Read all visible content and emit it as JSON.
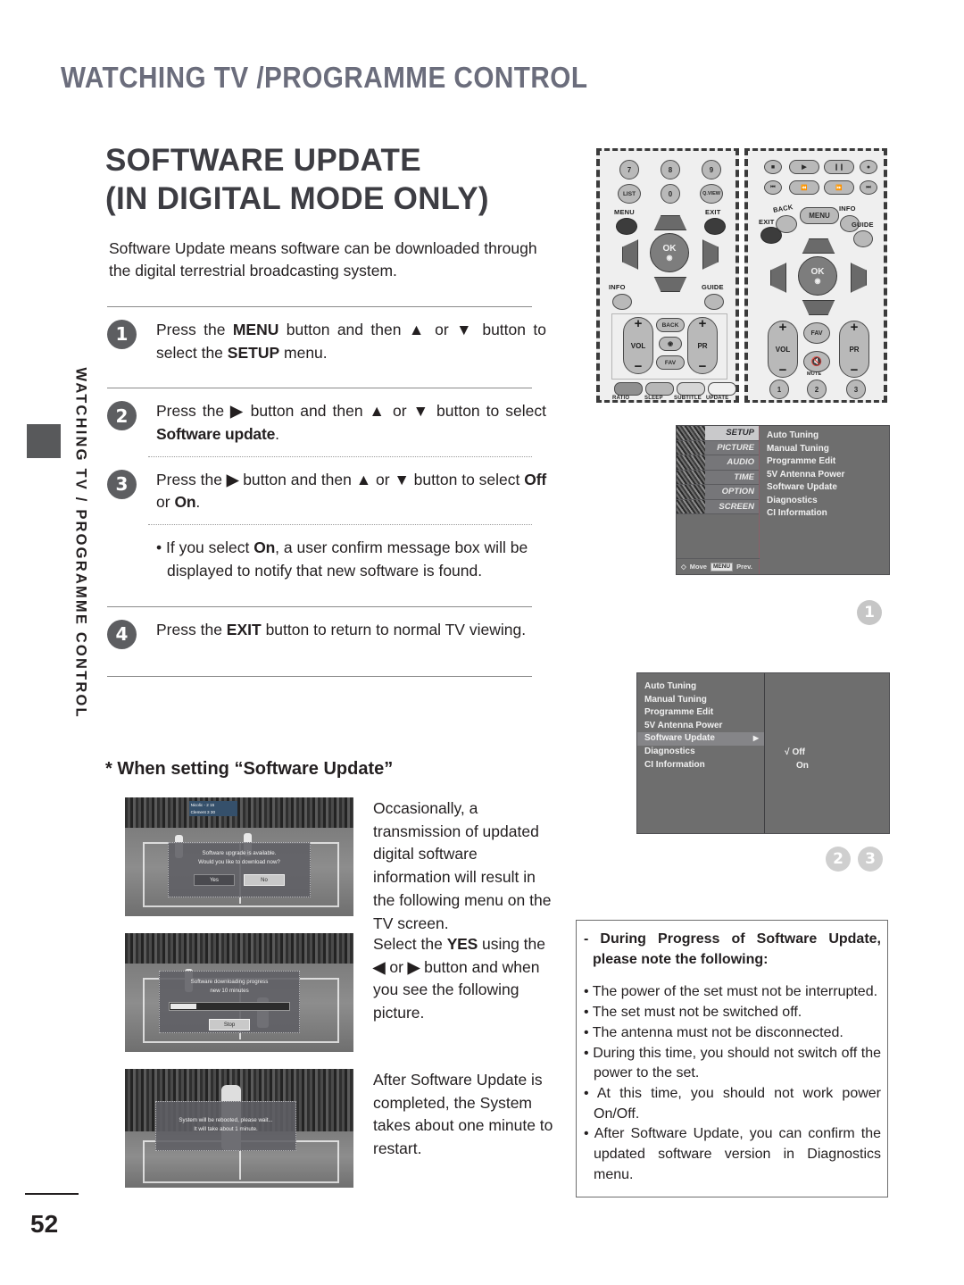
{
  "page": {
    "header_title": "WATCHING TV /PROGRAMME CONTROL",
    "side_tab_text": "WATCHING TV / PROGRAMME CONTROL",
    "page_number": "52"
  },
  "section": {
    "title_line1": "SOFTWARE UPDATE",
    "title_line2": "(IN DIGITAL MODE ONLY)",
    "intro": "Software Update means software can be downloaded through the digital terrestrial broadcasting system."
  },
  "steps": [
    {
      "num": "1",
      "parts": [
        {
          "t": "Press the ",
          "s": "n"
        },
        {
          "t": "MENU",
          "s": "b"
        },
        {
          "t": " button and then ",
          "s": "n"
        },
        {
          "t": "▲",
          "s": "b"
        },
        {
          "t": " or ",
          "s": "n"
        },
        {
          "t": "▼",
          "s": "b"
        },
        {
          "t": " button to select the ",
          "s": "n"
        },
        {
          "t": "SETUP",
          "s": "b"
        },
        {
          "t": " menu.",
          "s": "n"
        }
      ]
    },
    {
      "num": "2",
      "parts": [
        {
          "t": "Press the ",
          "s": "n"
        },
        {
          "t": "▶",
          "s": "b"
        },
        {
          "t": " button and then ",
          "s": "n"
        },
        {
          "t": "▲",
          "s": "b"
        },
        {
          "t": " or ",
          "s": "n"
        },
        {
          "t": "▼",
          "s": "b"
        },
        {
          "t": " button to select ",
          "s": "n"
        },
        {
          "t": "Software update",
          "s": "h"
        },
        {
          "t": ".",
          "s": "n"
        }
      ]
    },
    {
      "num": "3",
      "parts": [
        {
          "t": "Press the ",
          "s": "n"
        },
        {
          "t": "▶",
          "s": "b"
        },
        {
          "t": " button and then ",
          "s": "n"
        },
        {
          "t": "▲",
          "s": "b"
        },
        {
          "t": " or ",
          "s": "n"
        },
        {
          "t": "▼",
          "s": "b"
        },
        {
          "t": " button to select ",
          "s": "n"
        },
        {
          "t": "Off",
          "s": "h"
        },
        {
          "t": " or ",
          "s": "n"
        },
        {
          "t": "On",
          "s": "h"
        },
        {
          "t": ".",
          "s": "n"
        }
      ]
    },
    {
      "num": "4",
      "parts": [
        {
          "t": "Press the ",
          "s": "n"
        },
        {
          "t": "EXIT",
          "s": "b"
        },
        {
          "t": " button to return to normal TV viewing.",
          "s": "n"
        }
      ]
    }
  ],
  "note": {
    "parts": [
      {
        "t": "• If you select ",
        "s": "n"
      },
      {
        "t": "On",
        "s": "h"
      },
      {
        "t": ", a user confirm message box will be displayed to notify that new software is found.",
        "s": "n"
      }
    ]
  },
  "when_setting": {
    "heading": "* When setting “Software Update”",
    "shots": [
      {
        "score_line1": "Nicolic  -  2  15",
        "score_line2": "Clement   3  30",
        "dialog_msg": "Software upgrade is available.\nWould you like to download now?",
        "buttons": [
          "Yes",
          "No"
        ],
        "selected_button": "No",
        "caption": "Occasionally, a transmission of updated digital software information will result in the following menu on the TV screen."
      },
      {
        "dialog_msg": "Software downloading progress\nnew 10 minutes",
        "buttons": [
          "Stop"
        ],
        "progress_percent": "22",
        "caption_parts": [
          {
            "t": "Select the ",
            "s": "n"
          },
          {
            "t": "YES",
            "s": "h"
          },
          {
            "t": " using the ",
            "s": "n"
          },
          {
            "t": "◀",
            "s": "b"
          },
          {
            "t": " or ",
            "s": "n"
          },
          {
            "t": "▶",
            "s": "b"
          },
          {
            "t": " button and when you see the following picture.",
            "s": "n"
          }
        ]
      },
      {
        "dialog_msg": "System will be rebooted, please wait...\nIt will take about 1 minute.",
        "caption": "After Software Update is completed, the System takes about one minute to restart."
      }
    ]
  },
  "remotes": [
    {
      "name": "remote-numeric",
      "keys_row1": [
        "7",
        "8",
        "9"
      ],
      "keys_row2": [
        "LIST",
        "0",
        "Q.VIEW"
      ],
      "menu_label": "MENU",
      "exit_label": "EXIT",
      "info_label": "INFO",
      "guide_label": "GUIDE",
      "ok_label": "OK",
      "vol_label": "VOL",
      "pr_label": "PR",
      "back_label": "BACK",
      "fav_label": "FAV",
      "bottom_labels": [
        "RATIO",
        "SLEEP",
        "SUBTITLE",
        "UPDATE"
      ]
    },
    {
      "name": "remote-media",
      "transport_row1": [
        "■",
        "▶",
        "❙❙",
        "●"
      ],
      "transport_row2": [
        "⏮",
        "⏪",
        "⏩",
        "⏭"
      ],
      "back_label": "BACK",
      "menu_label": "MENU",
      "info_label": "INFO",
      "exit_label": "EXIT",
      "guide_label": "GUIDE",
      "ok_label": "OK",
      "vol_label": "VOL",
      "pr_label": "PR",
      "fav_label": "FAV",
      "mute_label": "MUTE",
      "bottom_numbers": [
        "1",
        "2",
        "3"
      ]
    }
  ],
  "osd_setup": {
    "tabs": [
      "SETUP",
      "PICTURE",
      "AUDIO",
      "TIME",
      "OPTION",
      "SCREEN"
    ],
    "active_tab": "SETUP",
    "items": [
      "Auto Tuning",
      "Manual Tuning",
      "Programme Edit",
      "5V Antenna Power",
      "Software Update",
      "Diagnostics",
      "CI Information"
    ],
    "footer_move": "Move",
    "footer_key": "MENU",
    "footer_prev": "Prev.",
    "marker": "1"
  },
  "osd_submenu": {
    "items": [
      "Auto Tuning",
      "Manual Tuning",
      "Programme Edit",
      "5V Antenna Power",
      "Software Update",
      "Diagnostics",
      "CI Information"
    ],
    "selected_item": "Software Update",
    "arrow": "▶",
    "options": [
      "Off",
      "On"
    ],
    "checked_option": "Off",
    "check_glyph": "√",
    "markers": [
      "2",
      "3"
    ]
  },
  "warning": {
    "heading": "- During Progress of Software Update, please note the following:",
    "bullets": [
      "• The power of the set must not be interrupted.",
      "• The set must not be switched off.",
      "• The antenna must not be disconnected.",
      "• During this time, you should not switch off the power to the set.",
      "• At this time, you should not work power On/Off.",
      "• After Software Update, you can confirm the updated software version in Diagnostics menu."
    ]
  },
  "colors": {
    "header_text": "#6b6d7c",
    "bullet_bg": "#5d5e61",
    "osd_bg": "#6e6e6e",
    "marker_bg": "#c6c6c6"
  }
}
